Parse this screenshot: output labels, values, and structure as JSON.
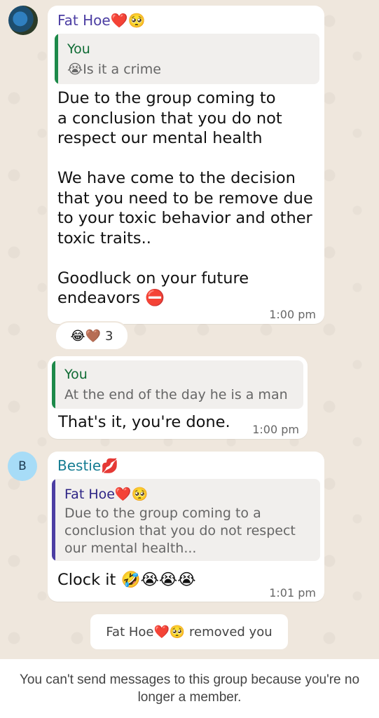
{
  "colors": {
    "background": "#efe7dd",
    "bubble": "#ffffff",
    "sender_1": "#4c3ea3",
    "sender_2": "#157c92",
    "quote_you": "#1d8a4a",
    "quote_fathoe": "#4c3ea3",
    "quote_name_you": "#0f6b34"
  },
  "messages": [
    {
      "sender": "Fat Hoe❤️🥺",
      "quote": {
        "name": "You",
        "text": "😭Is it a crime"
      },
      "body": "Due to the group coming to\na conclusion that you do not\nrespect our mental health\n\nWe have come to the decision\nthat you need to be remove due\nto your toxic behavior and other\ntoxic traits..\n\nGoodluck on your future\nendeavors ⛔",
      "time": "1:00 pm",
      "reactions": {
        "emojis": "😂🤎",
        "count": "3"
      }
    },
    {
      "sender": "",
      "quote": {
        "name": "You",
        "text": "At the end of the day he is a man"
      },
      "body": "That's it, you're done.",
      "time": "1:00 pm"
    },
    {
      "sender": "Bestie💋",
      "quote": {
        "name": "Fat Hoe❤️🥺",
        "text": "Due to the group coming to a\nconclusion that you do not respect\nour mental health..."
      },
      "body": "Clock it 🤣😭😭😭",
      "time": "1:01 pm"
    }
  ],
  "avatars": {
    "bestie_initial": "B"
  },
  "system_message": "Fat Hoe❤️🥺 removed you",
  "footer": {
    "notice": "You can't send messages to this group because you're no longer a member."
  }
}
